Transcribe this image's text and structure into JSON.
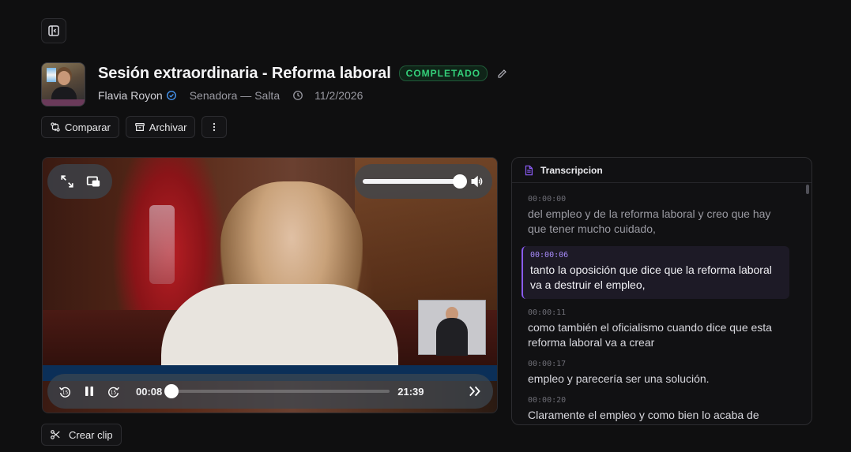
{
  "header": {
    "title": "Sesión extraordinaria - Reforma laboral",
    "status": "COMPLETADO",
    "speaker": "Flavia Royon",
    "role": "Senadora — Salta",
    "date": "11/2/2026"
  },
  "actions": {
    "compare_label": "Comparar",
    "archive_label": "Archivar"
  },
  "player": {
    "current_time": "00:08",
    "duration": "21:39",
    "volume": 1.0,
    "progress": 0.006
  },
  "clip": {
    "create_label": "Crear clip"
  },
  "transcript": {
    "title": "Transcripcion",
    "segments": [
      {
        "time": "00:00:00",
        "text": "del empleo y de la reforma laboral y creo que hay que tener mucho cuidado,"
      },
      {
        "time": "00:00:06",
        "text": "tanto la oposición que dice que la reforma laboral va a destruir el empleo,"
      },
      {
        "time": "00:00:11",
        "text": "como también el oficialismo cuando dice que esta reforma laboral va a crear"
      },
      {
        "time": "00:00:17",
        "text": "empleo y parecería ser una solución."
      },
      {
        "time": "00:00:20",
        "text": "Claramente el empleo y como bien lo acaba de"
      }
    ]
  },
  "colors": {
    "accent": "#8b5cf6",
    "status_green": "#34d07a",
    "verified_blue": "#4a9eff"
  },
  "icons": {
    "sidebar_toggle": "sidebar-collapse-icon",
    "edit": "pencil-icon",
    "verified": "verified-check-icon",
    "clock": "clock-icon",
    "compare": "compare-arrows-icon",
    "archive": "archive-box-icon",
    "more": "vertical-dots-icon",
    "fullscreen": "expand-icon",
    "pip": "picture-in-picture-icon",
    "volume": "volume-icon",
    "rewind": "rewind-15-icon",
    "pause": "pause-icon",
    "forward": "forward-15-icon",
    "speed": "fast-forward-icon",
    "scissors": "scissors-icon",
    "document": "document-icon"
  }
}
